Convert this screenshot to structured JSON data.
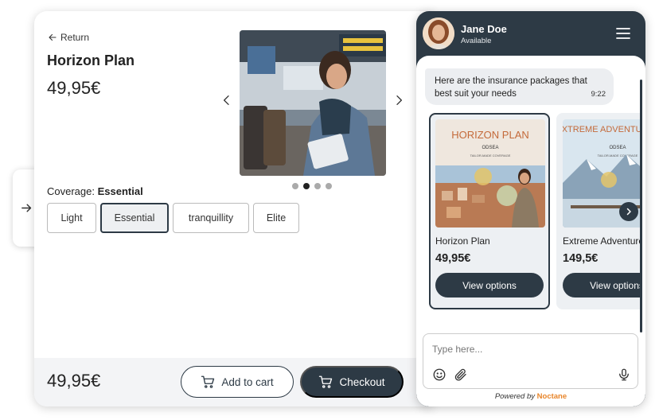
{
  "product": {
    "return_label": "Return",
    "title": "Horizon Plan",
    "price": "49,95€",
    "coverage_prefix": "Coverage:",
    "coverage_selected": "Essential",
    "coverage_options": [
      "Light",
      "Essential",
      "tranquillity",
      "Elite"
    ],
    "carousel": {
      "slide_count": 4,
      "active_index": 1
    }
  },
  "footer": {
    "price": "49,95€",
    "add_to_cart_label": "Add to cart",
    "checkout_label": "Checkout"
  },
  "chat": {
    "agent_name": "Jane Doe",
    "agent_status": "Available",
    "message": {
      "text": "Here are the insurance packages that best suit your needs",
      "time": "9:22"
    },
    "cards": [
      {
        "poster_title": "HORIZON PLAN",
        "poster_brand": "ODSEA",
        "poster_tagline": "TAILOR-MADE COVERAGE",
        "name": "Horizon Plan",
        "price": "49,95€",
        "button_label": "View options"
      },
      {
        "poster_title": "EXTREME ADVENTURE PLAN",
        "poster_brand": "ODSEA",
        "poster_tagline": "TAILOR-MADE COVERAGE",
        "name": "Extreme Adventure Plan",
        "price": "149,5€",
        "button_label": "View options"
      }
    ],
    "input_placeholder": "Type here...",
    "powered_by_prefix": "Powered by",
    "powered_by_brand": "Noctane"
  },
  "colors": {
    "primary": "#2d3a45",
    "card_bg": "#edf0f3",
    "bubble_bg": "#eceef1",
    "footer_bg": "#f3f4f6",
    "brand_orange": "#e8852a"
  },
  "icons": [
    "arrow-right-icon",
    "arrow-left-icon",
    "chevron-left-icon",
    "chevron-right-icon",
    "cart-icon",
    "menu-icon",
    "emoji-icon",
    "paperclip-icon",
    "microphone-icon"
  ]
}
